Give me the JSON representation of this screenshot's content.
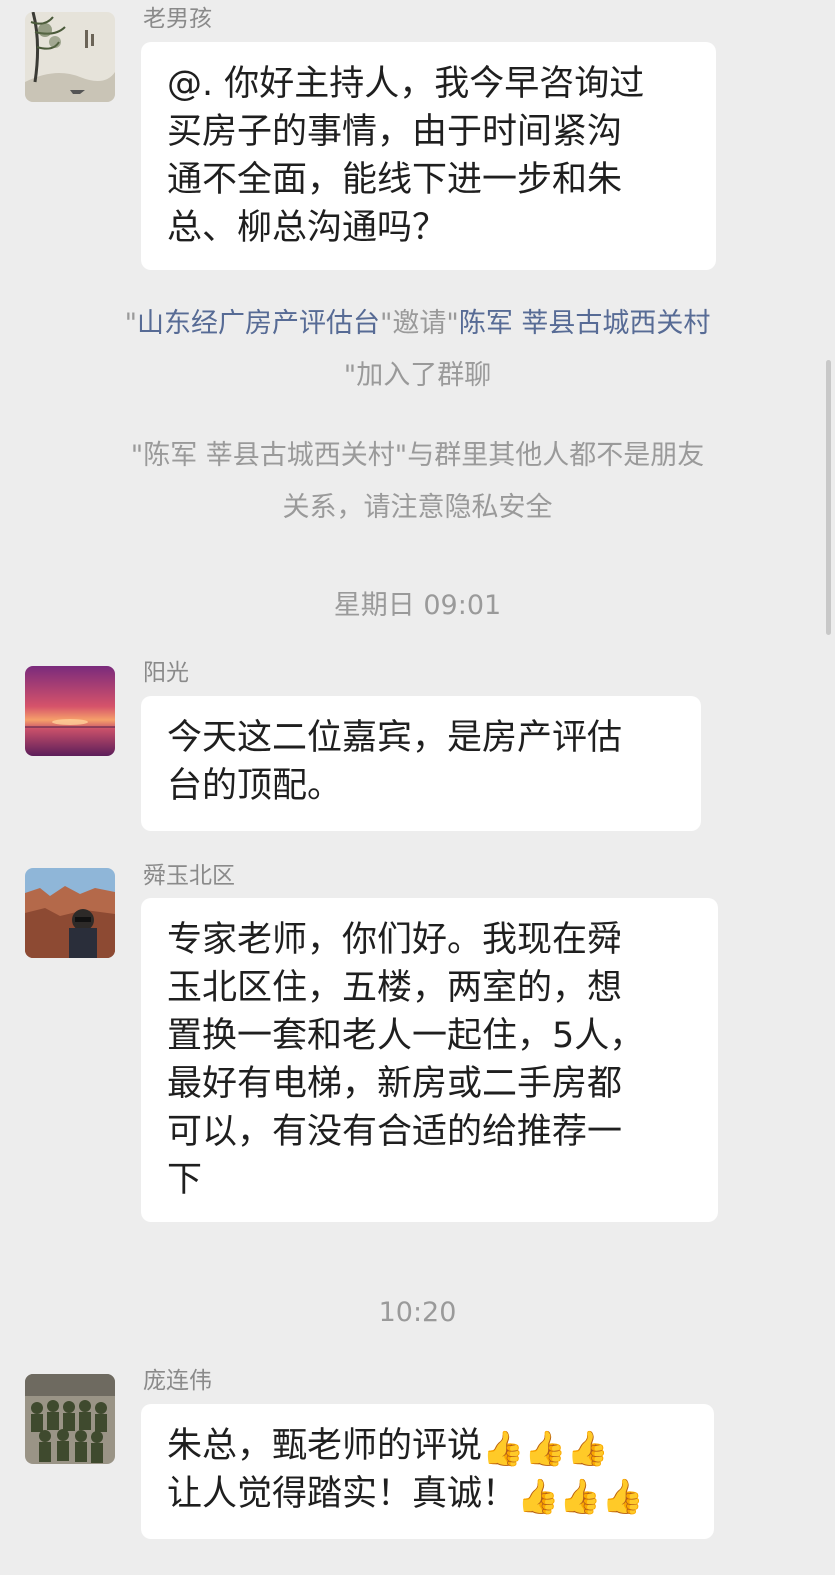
{
  "messages": [
    {
      "sender": "老男孩",
      "avatar_icon": "ink-painting-avatar",
      "lines": [
        "@. 你好主持人，我今早咨询过",
        "买房子的事情，由于时间紧沟",
        "通不全面，能线下进一步和朱",
        "总、柳总沟通吗？"
      ]
    },
    {
      "sender": "阳光",
      "avatar_icon": "sunset-avatar",
      "lines": [
        "今天这二位嘉宾，是房产评估",
        "台的顶配。"
      ]
    },
    {
      "sender": "舜玉北区",
      "avatar_icon": "canyon-photo-avatar",
      "lines": [
        "专家老师，你们好。我现在舜",
        "玉北区住，五楼，两室的，想",
        "置换一套和老人一起住，5人，",
        "最好有电梯，新房或二手房都",
        "可以，有没有合适的给推荐一",
        "下"
      ]
    },
    {
      "sender": "庞连伟",
      "avatar_icon": "group-photo-avatar",
      "lines": [
        "朱总，甄老师的评说",
        "让人觉得踏实！真诚！"
      ],
      "emoji": "👍"
    }
  ],
  "system_notices": {
    "invite": {
      "q1": "\"",
      "inviter": "山东经广房产评估台",
      "q2": "\"邀请\"",
      "invitee": "陈军 莘县古城西关村",
      "q3": "\"加入了群聊"
    },
    "privacy": [
      "\"陈军 莘县古城西关村\"与群里其他人都不是朋友",
      "关系，请注意隐私安全"
    ]
  },
  "timestamps": [
    "星期日 09:01",
    "10:20"
  ],
  "colors": {
    "background": "#ededed",
    "bubble": "#ffffff",
    "link": "#576b95",
    "meta_text": "#9a9a9a"
  }
}
